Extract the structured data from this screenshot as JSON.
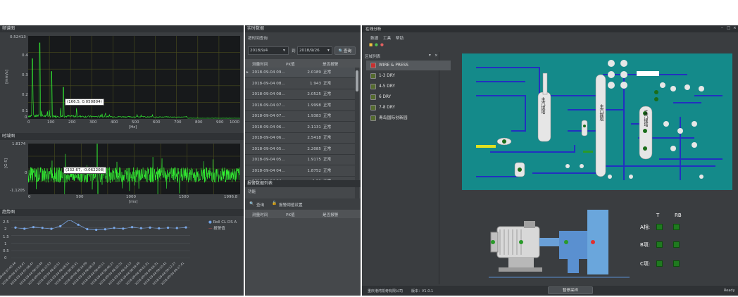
{
  "freq_panel": {
    "title": "频谱图",
    "y_max_label": "0.52413",
    "y_ticks": [
      "0.4",
      "0.3",
      "0.2",
      "0.1",
      "0"
    ],
    "y_unit": "[mm/s]",
    "x_ticks": [
      "0",
      "100",
      "200",
      "300",
      "400",
      "500",
      "600",
      "700",
      "800",
      "900",
      "1000"
    ],
    "x_unit": "[Hz]",
    "tooltip": "(166.5, 0.050804)"
  },
  "time_panel": {
    "title": "时域图",
    "y_ticks": [
      "1.8174",
      "0",
      "-1.1205"
    ],
    "y_unit": "[G-S]",
    "x_ticks": [
      "0",
      "500",
      "1000",
      "1500",
      "1996.8"
    ],
    "x_unit": "[ms]",
    "tooltip": "(332.67, -0.062208)"
  },
  "trend_panel": {
    "title": "趋势图",
    "y_ticks": [
      "2.5",
      "2",
      "1.5",
      "1",
      "0.5",
      "0"
    ],
    "legend": [
      "Roll CL DS A",
      "报警值"
    ],
    "x_labels": [
      "2018-09-04 07:40:44",
      "2018-09-04 07:54:47",
      "2018-09-04 07:58:47",
      "2018-09-04 08:10:49",
      "2018-09-04 08:12:53",
      "2018-09-04 08:20:57",
      "2018-09-04 08:28:51",
      "2018-09-04 08:30:41",
      "2018-09-04 08:34:09",
      "2018-09-04 08:38:19",
      "2018-09-04 08:40:11",
      "2018-09-04 08:46:27",
      "2018-09-04 08:50:22",
      "2018-09-04 08:54:13",
      "2018-09-04 08:59:49",
      "2018-09-04 09:01:31",
      "2018-09-04 09:06:31",
      "2018-09-04 09:10:42",
      "2018-09-04 09:12:27",
      "2018-09-04 09:17:41"
    ]
  },
  "realtime": {
    "title": "实时数据",
    "query_label": "按时间查询",
    "date_from": "2018/9/4",
    "to_label": "到",
    "date_to": "2018/9/26",
    "query_button": "查询",
    "columns": [
      "测量时间",
      "PK值",
      "是否报警"
    ],
    "rows": [
      [
        "2018-09-04 09...",
        "2.0189",
        "正常"
      ],
      [
        "2018-09-04 08...",
        "1.943",
        "正常"
      ],
      [
        "2018-09-04 08...",
        "2.0525",
        "正常"
      ],
      [
        "2018-09-04 07...",
        "1.9998",
        "正常"
      ],
      [
        "2018-09-04 07...",
        "1.9383",
        "正常"
      ],
      [
        "2018-09-04 06...",
        "2.1131",
        "正常"
      ],
      [
        "2018-09-04 06...",
        "2.5418",
        "正常"
      ],
      [
        "2018-09-04 05...",
        "2.2085",
        "正常"
      ],
      [
        "2018-09-04 05...",
        "1.9175",
        "正常"
      ],
      [
        "2018-09-04 04...",
        "1.8752",
        "正常"
      ],
      [
        "2018-09-04 04...",
        "1.91",
        "正常"
      ]
    ]
  },
  "alarm": {
    "title": "报警数据列表",
    "func_label": "功能",
    "query_btn": "查询",
    "settings_btn": "报警阈值设置",
    "columns": [
      "测量时间",
      "PK值",
      "是否报警"
    ]
  },
  "online": {
    "title": "在线分析",
    "win_btns": [
      "–",
      "□",
      "×"
    ],
    "menus": [
      "数据",
      "工具",
      "帮助"
    ],
    "region_title": "区域列表",
    "region_items": [
      "WIRE & PRESS",
      "1-3 DRY",
      "4-5 DRY",
      "6 DRY",
      "7-8 DRY",
      "青岛国际创新园"
    ],
    "tower_labels": [
      "主汽提塔",
      "主汽提塔",
      "主汽提塔"
    ],
    "lamp_headers": [
      "T",
      "RB"
    ],
    "phases": [
      "A相:",
      "B项:",
      "C项:"
    ],
    "status_company": "重庆港湾凯奇有限公司",
    "status_version": "版本：V1.0.1",
    "status_button": "暂停采样",
    "status_ready": "Ready"
  }
}
